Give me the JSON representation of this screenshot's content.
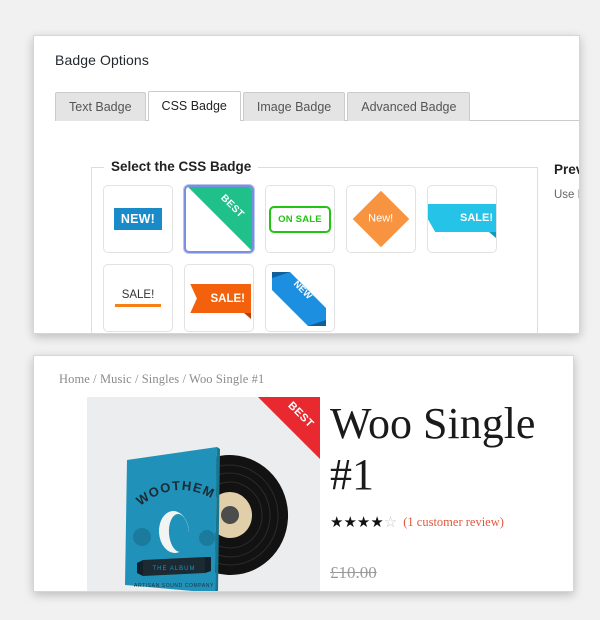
{
  "admin": {
    "panel_title": "Badge Options",
    "tabs": [
      {
        "label": "Text Badge",
        "active": false
      },
      {
        "label": "CSS Badge",
        "active": true
      },
      {
        "label": "Image Badge",
        "active": false
      },
      {
        "label": "Advanced Badge",
        "active": false
      }
    ],
    "fieldset_legend": "Select the CSS Badge",
    "badges": [
      {
        "name": "badge-new-rect",
        "label": "NEW!",
        "style": "rect-blue",
        "color": "#1a8ac9",
        "selected": false
      },
      {
        "name": "badge-best-corner",
        "label": "BEST",
        "style": "corner-triangle",
        "color": "#20c08a",
        "selected": true
      },
      {
        "name": "badge-on-sale",
        "label": "ON SALE",
        "style": "outline-green",
        "color": "#22c412",
        "selected": false
      },
      {
        "name": "badge-new-diamond",
        "label": "New!",
        "style": "diamond-orange",
        "color": "#f8943f",
        "selected": false
      },
      {
        "name": "badge-sale-ribbon",
        "label": "SALE!",
        "style": "ribbon-cyan",
        "color": "#25c3e8",
        "selected": false
      },
      {
        "name": "badge-sale-underline",
        "label": "SALE!",
        "style": "underline",
        "color": "#f77f18",
        "selected": false
      },
      {
        "name": "badge-sale-flag",
        "label": "SALE!",
        "style": "flag-orange",
        "color": "#f4610d",
        "selected": false
      },
      {
        "name": "badge-new-diagonal",
        "label": "NEW",
        "style": "diagonal-blue",
        "color": "#1d8fe0",
        "selected": false
      }
    ],
    "preview": {
      "title": "Preview",
      "subtitle": "Use Drag"
    }
  },
  "product": {
    "breadcrumb": "Home / Music / Singles / Woo Single #1",
    "title": "Woo Single #1",
    "badge_label": "BEST",
    "badge_color": "#e8292f",
    "rating": {
      "filled": 4,
      "total": 5,
      "filled_glyphs": "★★★★",
      "empty_glyphs": "☆",
      "review_text": "(1 customer review)"
    },
    "price": "£10.00",
    "image": {
      "sleeve_text": "WOOTHEMES",
      "sleeve_sub": "ARTISAN SOUND COMPANY",
      "ribbon_text": "THE ALBUM"
    }
  }
}
